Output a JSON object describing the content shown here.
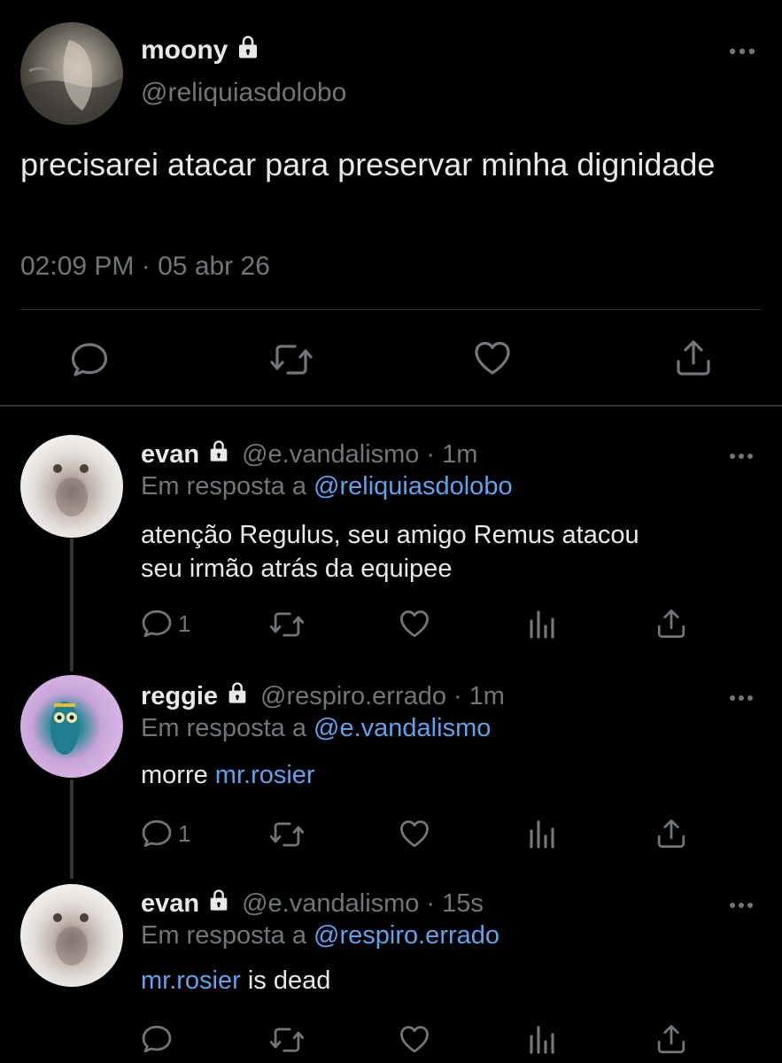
{
  "main_tweet": {
    "name": "moony",
    "handle": "@reliquiasdolobo",
    "text": "precisarei atacar para preservar minha dignidade",
    "timestamp": "02:09 PM",
    "separator": "·",
    "date": "05 abr 26",
    "actions": [
      "reply-icon",
      "retweet-icon",
      "like-icon",
      "share-icon"
    ]
  },
  "replies": [
    {
      "name": "evan",
      "handle": "@e.vandalismo",
      "separator": "·",
      "time": "1m",
      "reply_prefix": "Em resposta a",
      "reply_to": "@reliquiasdolobo",
      "text_line1": "atenção Regulus, seu amigo Remus atacou",
      "text_line2": "seu irmão atrás da equipee",
      "reply_count": "1",
      "avatar": "white-cat-avatar"
    },
    {
      "name": "reggie",
      "handle": "@respiro.errado",
      "separator": "·",
      "time": "1m",
      "reply_prefix": "Em resposta a",
      "reply_to": "@e.vandalismo",
      "text_plain": "morre",
      "text_link": "mr.rosier",
      "reply_count": "1",
      "avatar": "fish-avatar"
    },
    {
      "name": "evan",
      "handle": "@e.vandalismo",
      "separator": "·",
      "time": "15s",
      "reply_prefix": "Em resposta a",
      "reply_to": "@respiro.errado",
      "text_link": "mr.rosier",
      "text_plain": "is dead",
      "reply_count": "",
      "avatar": "white-cat-avatar"
    }
  ],
  "colors": {
    "background": "#000000",
    "text": "#e7e9ea",
    "secondary": "#71767b",
    "link": "#5ea3ec",
    "divider": "#2f3336"
  }
}
